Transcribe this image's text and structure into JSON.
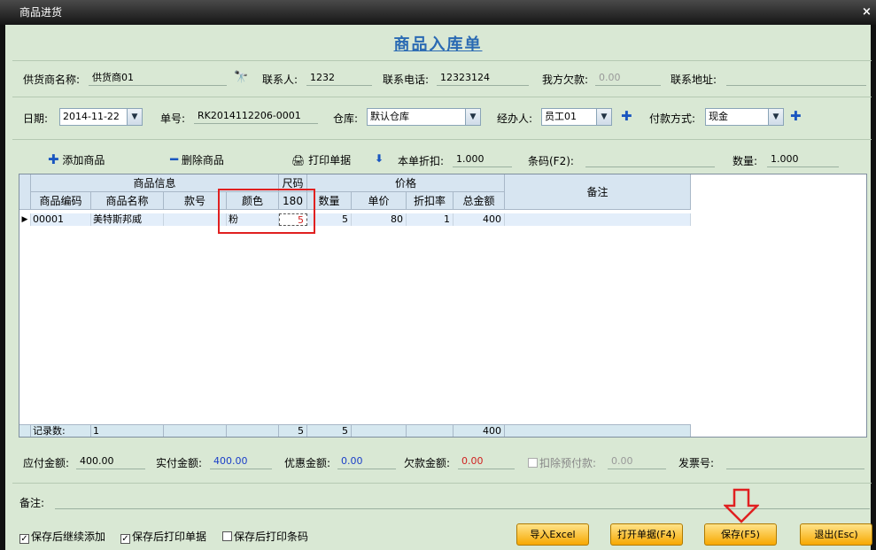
{
  "window": {
    "title": "商品进货",
    "close": "×"
  },
  "form_title": "商品入库单",
  "row1": {
    "supplier_label": "供货商名称:",
    "supplier_value": "供货商01",
    "contact_label": "联系人:",
    "contact_value": "1232",
    "phone_label": "联系电话:",
    "phone_value": "12323124",
    "owe_label": "我方欠款:",
    "owe_value": "0.00",
    "address_label": "联系地址:",
    "address_value": ""
  },
  "row2": {
    "date_label": "日期:",
    "date_value": "2014-11-22",
    "order_label": "单号:",
    "order_value": "RK2014112206-0001",
    "warehouse_label": "仓库:",
    "warehouse_value": "默认仓库",
    "handler_label": "经办人:",
    "handler_value": "员工01",
    "payment_label": "付款方式:",
    "payment_value": "现金"
  },
  "toolbar": {
    "add": "添加商品",
    "delete": "删除商品",
    "print": "打印单据",
    "discount_label": "本单折扣:",
    "discount_value": "1.000",
    "barcode_label": "条码(F2):",
    "barcode_value": "",
    "qty_label": "数量:",
    "qty_value": "1.000"
  },
  "grid": {
    "group_headers": [
      "商品信息",
      "尺码",
      "价格",
      "备注"
    ],
    "columns": [
      "商品编码",
      "商品名称",
      "款号",
      "颜色",
      "180",
      "数量",
      "单价",
      "折扣率",
      "总金额"
    ],
    "rows": [
      {
        "code": "00001",
        "name": "美特斯邦威",
        "style": "",
        "color": "粉",
        "size180": "5",
        "qty": "5",
        "price": "80",
        "rate": "1",
        "total": "400",
        "note": ""
      }
    ],
    "footer": {
      "label": "记录数:",
      "count": "1",
      "size180": "5",
      "qty": "5",
      "total": "400"
    }
  },
  "totals": {
    "payable_label": "应付金额:",
    "payable_value": "400.00",
    "paid_label": "实付金额:",
    "paid_value": "400.00",
    "discount_label": "优惠金额:",
    "discount_value": "0.00",
    "owed_label": "欠款金额:",
    "owed_value": "0.00",
    "prepay_label": "扣除预付款:",
    "prepay_value": "0.00",
    "invoice_label": "发票号:",
    "invoice_value": ""
  },
  "remark_label": "备注:",
  "options": {
    "continue_add": "保存后继续添加",
    "print_doc": "保存后打印单据",
    "print_barcode": "保存后打印条码"
  },
  "buttons": {
    "import": "导入Excel",
    "open": "打开单据(F4)",
    "save": "保存(F5)",
    "exit": "退出(Esc)"
  }
}
